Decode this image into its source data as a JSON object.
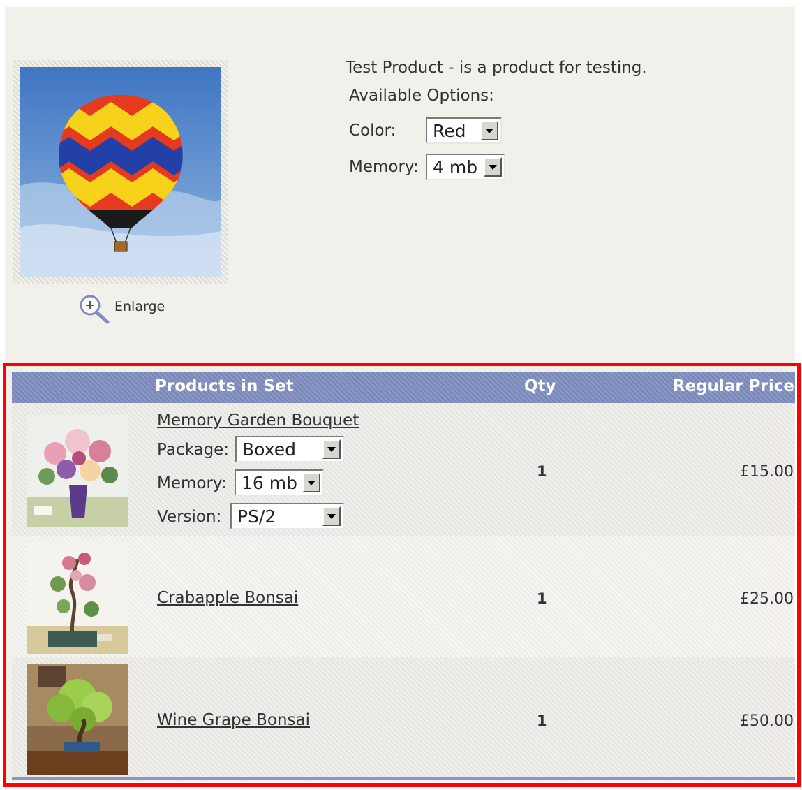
{
  "product": {
    "description": "Test Product - is a product for testing.",
    "options_heading": "Available Options:",
    "enlarge_label": "Enlarge",
    "options": [
      {
        "label": "Color:",
        "value": "Red"
      },
      {
        "label": "Memory:",
        "value": "4 mb"
      }
    ]
  },
  "set_table": {
    "headers": {
      "products": "Products in Set",
      "qty": "Qty",
      "price": "Regular Price"
    },
    "items": [
      {
        "name": "Memory Garden Bouquet",
        "qty": "1",
        "price": "£15.00",
        "options": [
          {
            "label": "Package:",
            "value": "Boxed"
          },
          {
            "label": "Memory:",
            "value": "16 mb"
          },
          {
            "label": "Version:",
            "value": "PS/2"
          }
        ]
      },
      {
        "name": "Crabapple Bonsai",
        "qty": "1",
        "price": "£25.00"
      },
      {
        "name": "Wine Grape Bonsai",
        "qty": "1",
        "price": "£50.00"
      }
    ]
  },
  "colors": {
    "page_background": "#f1f0eb",
    "header_background": "#7f8ebc",
    "highlight_border": "#ff0000"
  },
  "icons": [
    "zoom-in-icon",
    "dropdown-arrow-icon"
  ]
}
